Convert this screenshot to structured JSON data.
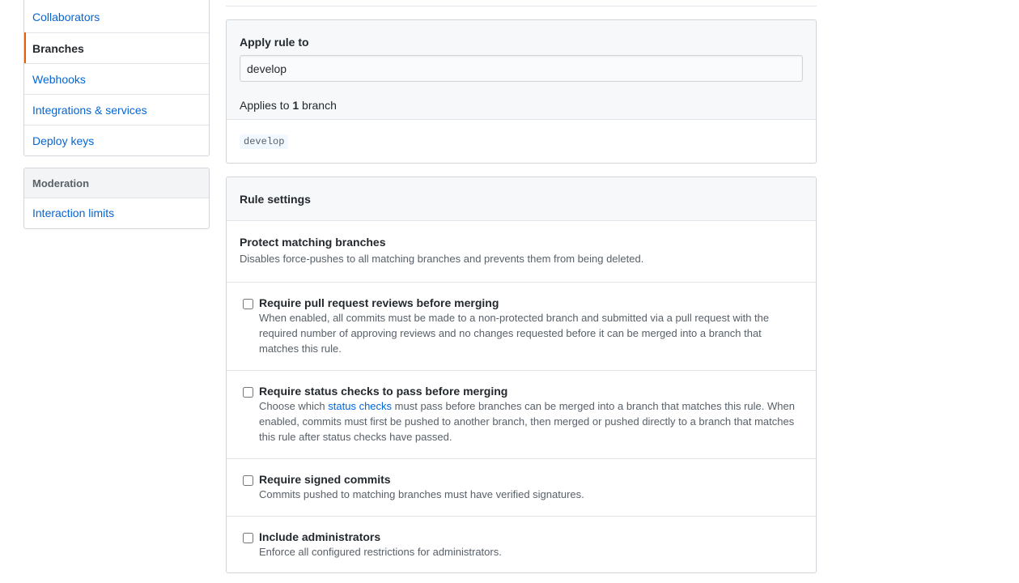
{
  "sidebar": {
    "menu1_items": [
      {
        "label": "Collaborators",
        "selected": false
      },
      {
        "label": "Branches",
        "selected": true
      },
      {
        "label": "Webhooks",
        "selected": false
      },
      {
        "label": "Integrations & services",
        "selected": false
      },
      {
        "label": "Deploy keys",
        "selected": false
      }
    ],
    "moderation": {
      "heading": "Moderation",
      "items": [
        {
          "label": "Interaction limits"
        }
      ]
    },
    "selected_accent": "#e36209"
  },
  "apply_rule": {
    "label": "Apply rule to",
    "pattern_value": "develop",
    "applies_prefix": "Applies to ",
    "applies_count": "1",
    "applies_suffix": " branch",
    "matched_branches": [
      "develop"
    ]
  },
  "rule_settings": {
    "heading": "Rule settings",
    "protect_title": "Protect matching branches",
    "protect_desc": "Disables force-pushes to all matching branches and prevents them from being deleted.",
    "options": [
      {
        "title": "Require pull request reviews before merging",
        "desc": "When enabled, all commits must be made to a non-protected branch and submitted via a pull request with the required number of approving reviews and no changes requested before it can be merged into a branch that matches this rule.",
        "checked": false
      },
      {
        "title": "Require status checks to pass before merging",
        "desc_before": "Choose which ",
        "desc_link": "status checks",
        "desc_after": " must pass before branches can be merged into a branch that matches this rule. When enabled, commits must first be pushed to another branch, then merged or pushed directly to a branch that matches this rule after status checks have passed.",
        "checked": false
      },
      {
        "title": "Require signed commits",
        "desc": "Commits pushed to matching branches must have verified signatures.",
        "checked": false
      },
      {
        "title": "Include administrators",
        "desc": "Enforce all configured restrictions for administrators.",
        "checked": false
      }
    ]
  },
  "colors": {
    "link": "#0366d6",
    "border": "#d1d5da",
    "header_bg": "#f6f8fa"
  }
}
